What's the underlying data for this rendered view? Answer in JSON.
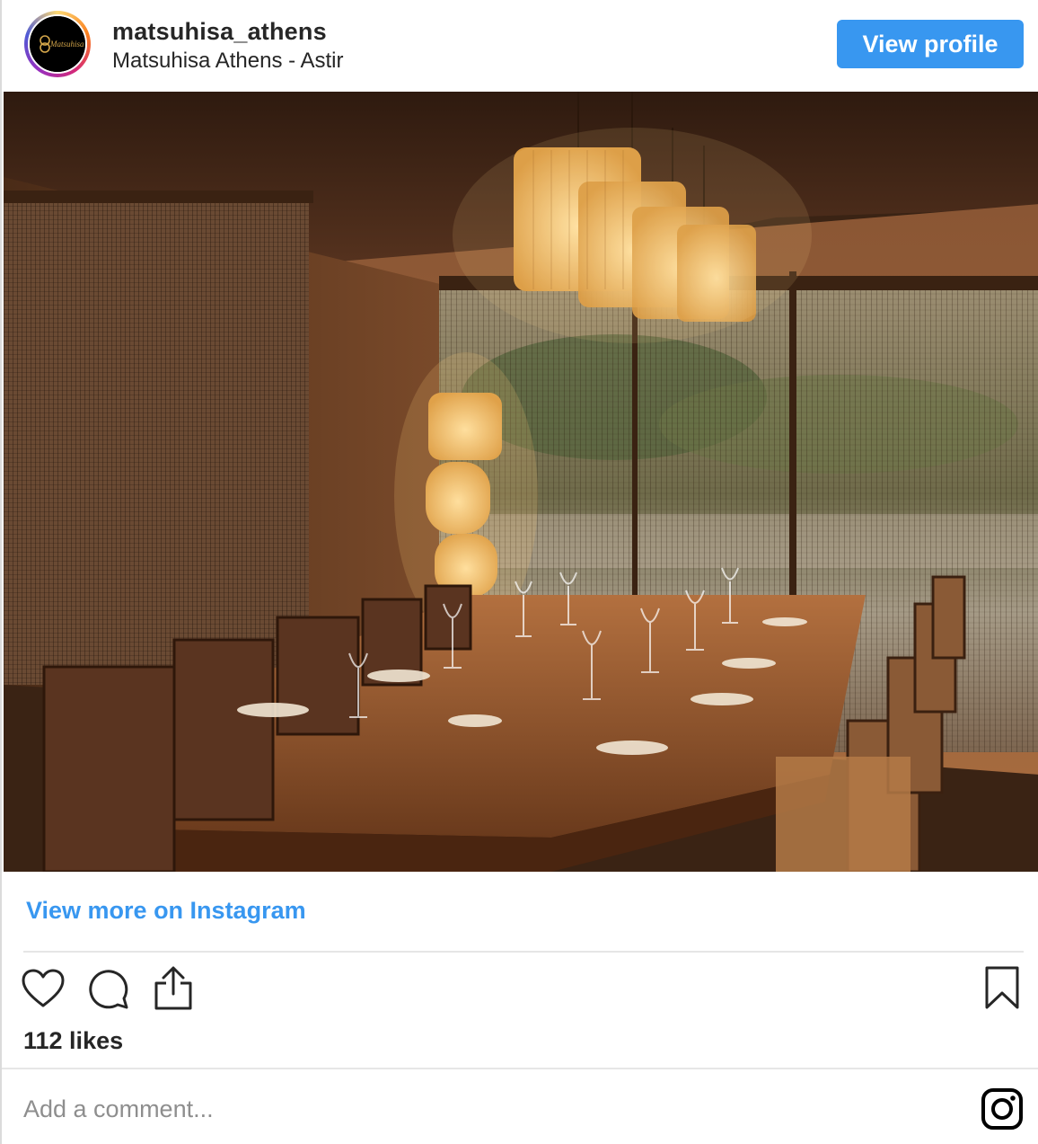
{
  "header": {
    "username": "matsuhisa_athens",
    "location": "Matsuhisa Athens - Astir",
    "view_profile_label": "View profile",
    "avatar_logo_text": "Matsuhisa"
  },
  "post": {
    "image_alt": "Private dining room with long wooden table, lanterns and bamboo blinds",
    "view_more_label": "View more on Instagram",
    "likes_text": "112 likes"
  },
  "actions": {
    "like_icon": "heart-icon",
    "comment_icon": "comment-icon",
    "share_icon": "share-icon",
    "save_icon": "bookmark-icon"
  },
  "comment": {
    "placeholder": "Add a comment..."
  },
  "colors": {
    "accent": "#3897f0",
    "text": "#262626",
    "muted": "#8e8e8e",
    "divider": "#e6e6e6"
  }
}
